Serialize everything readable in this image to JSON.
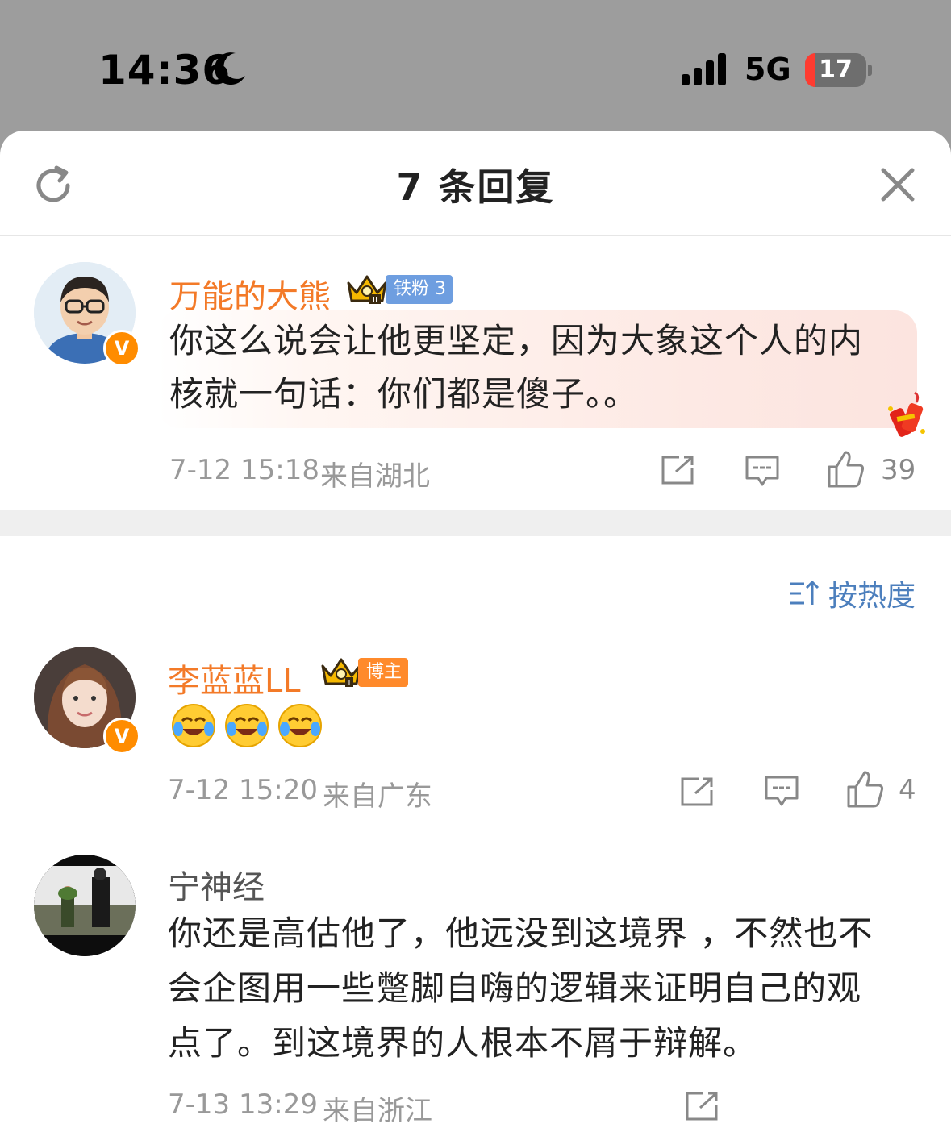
{
  "status_bar": {
    "time": "14:36",
    "network": "5G",
    "battery_level": "17",
    "battery_fraction": 0.17,
    "icons": [
      "moon-icon",
      "signal-icon",
      "battery-icon"
    ]
  },
  "header": {
    "title": "7 条回复",
    "refresh_icon": "refresh-icon",
    "close_icon": "close-icon"
  },
  "root_comment": {
    "username": "万能的大熊",
    "badge_label": "铁粉 3",
    "text_line1": "你这么说会让他更坚定，因为大象这个人的内",
    "text_line2": "核就一句话：你们都是傻子。。",
    "date": "7-12 15:18",
    "location": "来自湖北",
    "likes": "39"
  },
  "sort": {
    "label": "按热度"
  },
  "replies": [
    {
      "username": "李蓝蓝LL",
      "badge_label": "博主",
      "emojis": [
        "laugh-cry-emoji",
        "laugh-cry-emoji",
        "laugh-cry-emoji"
      ],
      "date": "7-12 15:20",
      "location": "来自广东",
      "likes": "4"
    },
    {
      "username": "宁神经",
      "text_line1": "你还是高估他了，他远没到这境界 ，不然也不",
      "text_line2": "会企图用一些蹩脚自嗨的逻辑来证明自己的观",
      "text_line3": "点了。到这境界的人根本不屑于辩解。",
      "date": "7-13 13:29",
      "location": "来自浙江"
    }
  ],
  "colors": {
    "username_orange": "#f37a28",
    "link_blue": "#4c7fbd",
    "meta_gray": "#999999",
    "verified_orange": "#ff8c00"
  }
}
